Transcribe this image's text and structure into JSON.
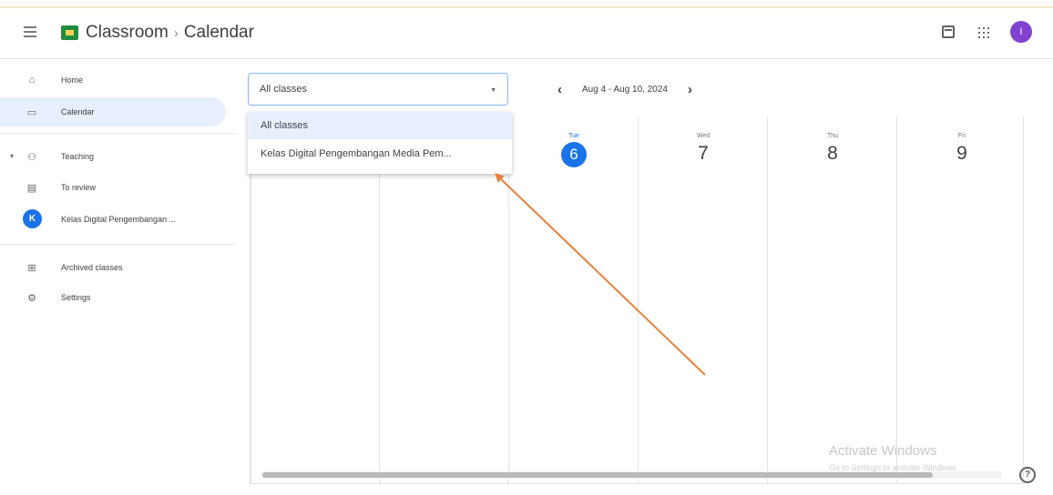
{
  "header": {
    "app_name": "Classroom",
    "separator": "›",
    "page": "Calendar",
    "avatar_initial": "I",
    "avatar_color": "#8142d1"
  },
  "sidebar": {
    "items": [
      {
        "label": "Home",
        "icon": "home-icon"
      },
      {
        "label": "Calendar",
        "icon": "calendar-icon"
      },
      {
        "label": "Teaching",
        "icon": "people-icon"
      },
      {
        "label": "To review",
        "icon": "folder-icon"
      },
      {
        "label": "Kelas Digital Pengembangan ...",
        "icon": "class-badge",
        "badge": "K"
      },
      {
        "label": "Archived classes",
        "icon": "archive-icon"
      },
      {
        "label": "Settings",
        "icon": "gear-icon"
      }
    ]
  },
  "filter": {
    "selected": "All classes",
    "options": [
      "All classes",
      "Kelas Digital Pengembangan Media Pem..."
    ]
  },
  "week": {
    "range": "Aug 4 - Aug 10, 2024",
    "days": [
      {
        "name": "Tue",
        "num": "6",
        "today": true
      },
      {
        "name": "Wed",
        "num": "7",
        "today": false
      },
      {
        "name": "Thu",
        "num": "8",
        "today": false
      },
      {
        "name": "Fri",
        "num": "9",
        "today": false
      }
    ]
  },
  "watermark": {
    "line1": "Activate Windows",
    "line2": "Go to Settings to activate Windows."
  },
  "help": "?",
  "colors": {
    "accent": "#1a73e8",
    "annotation_arrow": "#e8803a"
  }
}
